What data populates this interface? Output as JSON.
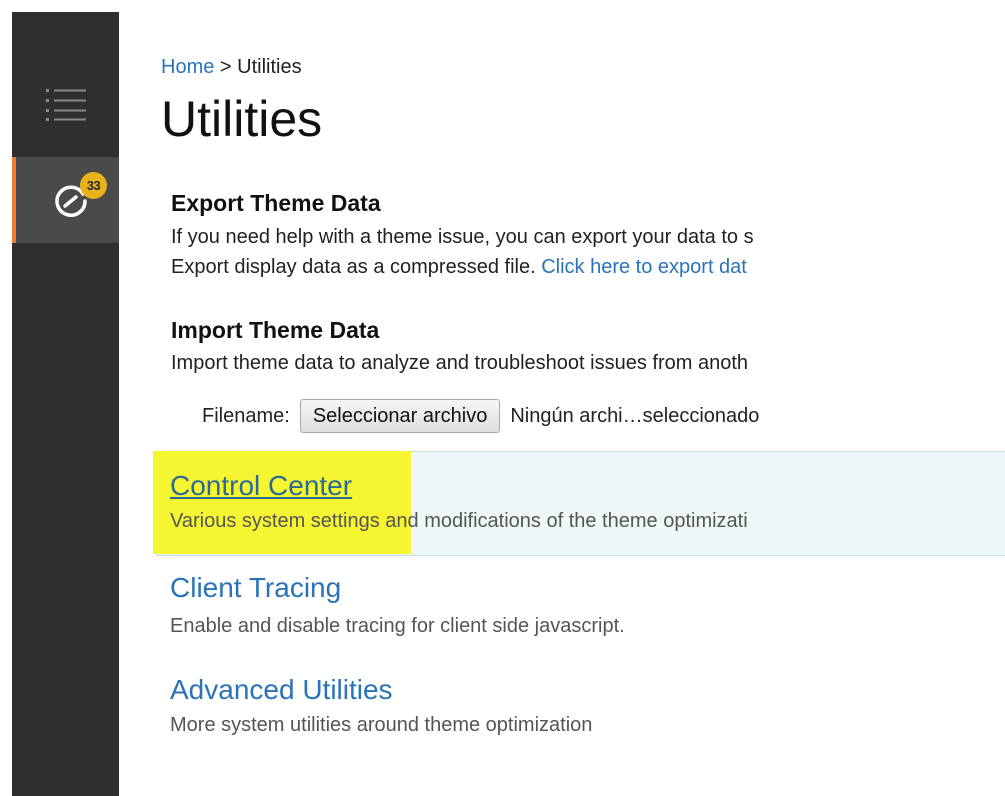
{
  "sidebar": {
    "menu_icon": "list-icon",
    "active_item": {
      "icon": "gauge-icon",
      "badge_count": "33",
      "accent_color": "#f07b2a"
    }
  },
  "breadcrumb": {
    "home": "Home",
    "separator": ">",
    "current": "Utilities"
  },
  "page_title": "Utilities",
  "export": {
    "title": "Export Theme Data",
    "line1": "If you need help with a theme issue, you can export your data to s",
    "line2_text": "Export display data as a compressed file.",
    "line2_link": "Click here to export dat"
  },
  "import": {
    "title": "Import Theme Data",
    "desc": "Import theme data to analyze and troubleshoot issues from anoth",
    "filename_label": "Filename:",
    "file_button": "Seleccionar archivo",
    "file_status": "Ningún archi…seleccionado"
  },
  "utilities": [
    {
      "title": "Control Center",
      "desc": "Various system settings and modifications of the theme optimizati"
    },
    {
      "title": "Client Tracing",
      "desc": "Enable and disable tracing for client side javascript."
    },
    {
      "title": "Advanced Utilities",
      "desc": "More system utilities around theme optimization"
    }
  ],
  "colors": {
    "sidebar_bg": "#2f2f2f",
    "link": "#2a73b8",
    "badge": "#e8b21a",
    "highlight": "#f5f531",
    "panel_bg": "#eef8f9"
  }
}
